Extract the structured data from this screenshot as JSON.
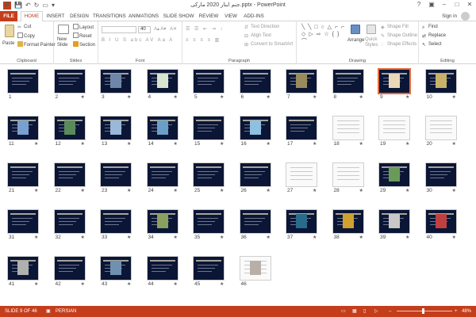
{
  "app": {
    "title": "جنم ابنار 2020 مارکی.pptx - PowerPoint",
    "sign_in": "Sign in"
  },
  "tabs": [
    "FILE",
    "HOME",
    "INSERT",
    "DESIGN",
    "TRANSITIONS",
    "ANIMATIONS",
    "SLIDE SHOW",
    "REVIEW",
    "VIEW",
    "ADD-INS"
  ],
  "ribbon": {
    "clipboard": {
      "label": "Clipboard",
      "paste": "Paste",
      "cut": "Cut",
      "copy": "Copy",
      "format_painter": "Format Painter"
    },
    "slides": {
      "label": "Slides",
      "new_slide": "New Slide",
      "layout": "Layout",
      "reset": "Reset",
      "section": "Section"
    },
    "font": {
      "label": "Font",
      "size": "40"
    },
    "paragraph": {
      "label": "Paragraph",
      "text_direction": "Text Direction",
      "align_text": "Align Text",
      "convert": "Convert to SmartArt"
    },
    "drawing": {
      "label": "Drawing",
      "arrange": "Arrange",
      "quick_styles": "Quick Styles",
      "shape_fill": "Shape Fill",
      "shape_outline": "Shape Outline",
      "shape_effects": "Shape Effects"
    },
    "editing": {
      "label": "Editing",
      "find": "Find",
      "replace": "Replace",
      "select": "Select"
    }
  },
  "slides": [
    {
      "n": "1",
      "star": ""
    },
    {
      "n": "2",
      "star": "★"
    },
    {
      "n": "3",
      "star": "★"
    },
    {
      "n": "4",
      "star": "★"
    },
    {
      "n": "5",
      "star": "★"
    },
    {
      "n": "6",
      "star": "★"
    },
    {
      "n": "7",
      "star": "★"
    },
    {
      "n": "8",
      "star": "★"
    },
    {
      "n": "9",
      "star": "★"
    },
    {
      "n": "10",
      "star": "★"
    },
    {
      "n": "11",
      "star": "★"
    },
    {
      "n": "12",
      "star": "★"
    },
    {
      "n": "13",
      "star": "★"
    },
    {
      "n": "14",
      "star": "★"
    },
    {
      "n": "15",
      "star": "★"
    },
    {
      "n": "16",
      "star": "★"
    },
    {
      "n": "17",
      "star": "★"
    },
    {
      "n": "18",
      "star": "★"
    },
    {
      "n": "19",
      "star": "★"
    },
    {
      "n": "20",
      "star": "★"
    },
    {
      "n": "21",
      "star": "★"
    },
    {
      "n": "22",
      "star": "★"
    },
    {
      "n": "23",
      "star": "★"
    },
    {
      "n": "24",
      "star": "★"
    },
    {
      "n": "25",
      "star": "★"
    },
    {
      "n": "26",
      "star": "★"
    },
    {
      "n": "27",
      "star": "★"
    },
    {
      "n": "28",
      "star": "★"
    },
    {
      "n": "29",
      "star": "★"
    },
    {
      "n": "30",
      "star": "★"
    },
    {
      "n": "31",
      "star": "★"
    },
    {
      "n": "32",
      "star": "★"
    },
    {
      "n": "33",
      "star": "★"
    },
    {
      "n": "34",
      "star": "★"
    },
    {
      "n": "35",
      "star": "★"
    },
    {
      "n": "36",
      "star": "★"
    },
    {
      "n": "37",
      "star": "★"
    },
    {
      "n": "38",
      "star": "★"
    },
    {
      "n": "39",
      "star": "★"
    },
    {
      "n": "40",
      "star": "★"
    },
    {
      "n": "41",
      "star": "★"
    },
    {
      "n": "42",
      "star": "★"
    },
    {
      "n": "43",
      "star": "★"
    },
    {
      "n": "44",
      "star": "★"
    },
    {
      "n": "45",
      "star": "★"
    },
    {
      "n": "46",
      "star": ""
    }
  ],
  "selected_slide": 9,
  "status": {
    "slide_info": "SLIDE 9 OF 46",
    "language": "PERSIAN",
    "zoom": "48%"
  },
  "colors": {
    "accent": "#c43e1c",
    "slide_bg": "#0b1636",
    "selection": "#e46b3c"
  }
}
